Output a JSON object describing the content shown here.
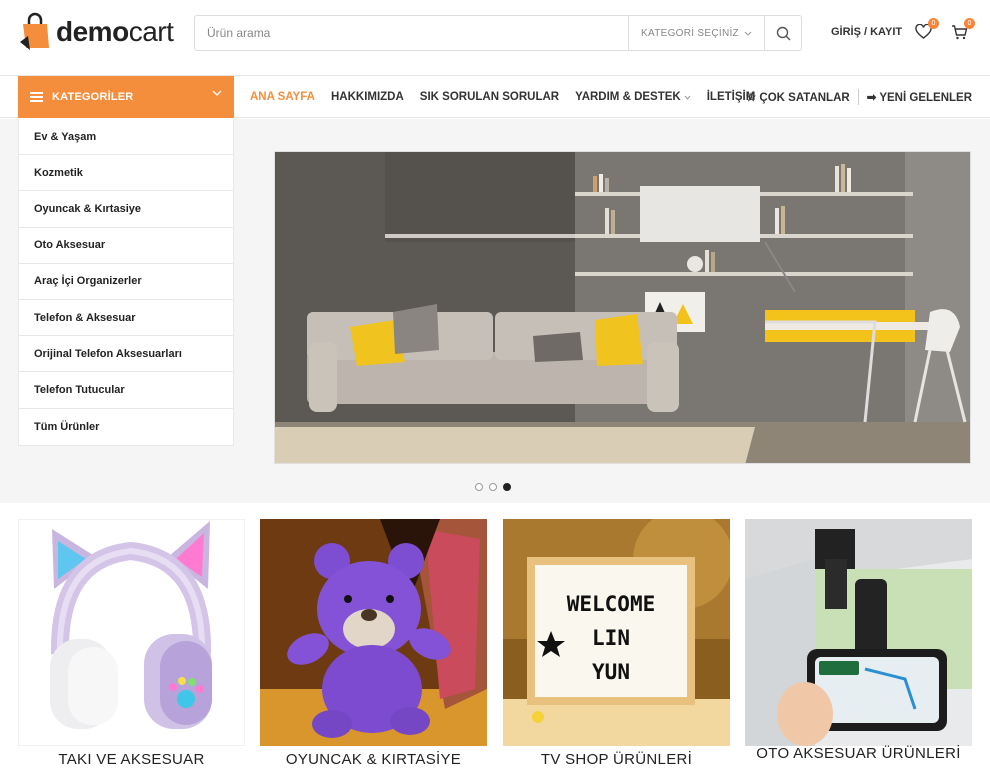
{
  "brand": {
    "name_bold": "demo",
    "name_light": "cart"
  },
  "search": {
    "placeholder": "Ürün arama",
    "category_label": "KATEGORİ SEÇİNİZ"
  },
  "header": {
    "login_label": "GİRİŞ / KAYIT",
    "wishlist_count": "0",
    "cart_count": "0"
  },
  "categories_button": "KATEGORİLER",
  "menu": [
    "ANA SAYFA",
    "HAKKIMIZDA",
    "SIK SORULAN SORULAR",
    "YARDIM & DESTEK",
    "İLETİŞİM"
  ],
  "menu_right": {
    "bestsellers": "ÇOK SATANLAR",
    "new_arrivals": "YENİ GELENLER"
  },
  "categories": [
    "Ev & Yaşam",
    "Kozmetik",
    "Oyuncak & Kırtasiye",
    "Oto Aksesuar",
    "Araç İçi Organizerler",
    "Telefon & Aksesuar",
    "Orijinal Telefon Aksesuarları",
    "Telefon Tutucular",
    "Tüm Ürünler"
  ],
  "slider": {
    "slide_count": 3,
    "active_slide": 3
  },
  "products": [
    {
      "title": "TAKI VE AKSESUAR"
    },
    {
      "title": "OYUNCAK & KIRTASİYE"
    },
    {
      "title": "TV SHOP ÜRÜNLERİ"
    },
    {
      "title": "OTO AKSESUAR ÜRÜNLERİ"
    }
  ],
  "lightbox_sign": [
    "WELCOME",
    "LIN",
    "YUN"
  ],
  "colors": {
    "accent": "#f58e3c"
  }
}
